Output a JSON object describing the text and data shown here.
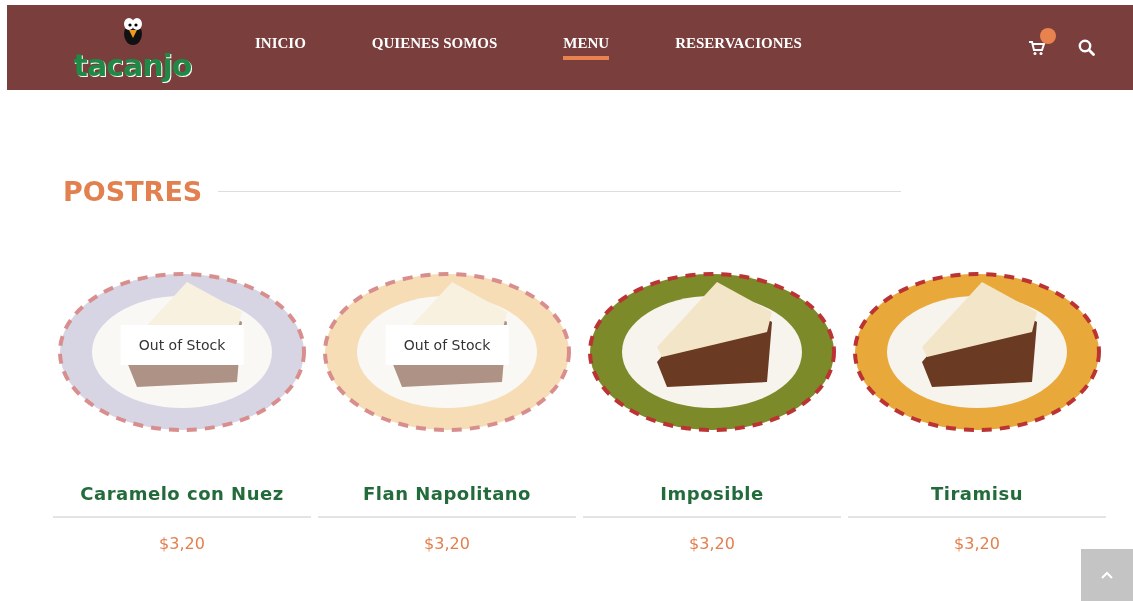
{
  "header": {
    "logo_text": "tacanjo",
    "nav": [
      {
        "label": "INICIO",
        "selected": false
      },
      {
        "label": "QUIENES SOMOS",
        "selected": false
      },
      {
        "label": "MENU",
        "selected": true
      },
      {
        "label": "RESERVACIONES",
        "selected": false
      }
    ],
    "cart_badge": true
  },
  "section": {
    "title": "POSTRES"
  },
  "products": [
    {
      "name": "Caramelo con Nuez",
      "price": "$3,20",
      "out_of_stock": true,
      "badge": "Out of Stock"
    },
    {
      "name": "Flan Napolitano",
      "price": "$3,20",
      "out_of_stock": true,
      "badge": "Out of Stock"
    },
    {
      "name": "Imposible",
      "price": "$3,20",
      "out_of_stock": false
    },
    {
      "name": "Tiramisu",
      "price": "$3,20",
      "out_of_stock": false
    }
  ]
}
